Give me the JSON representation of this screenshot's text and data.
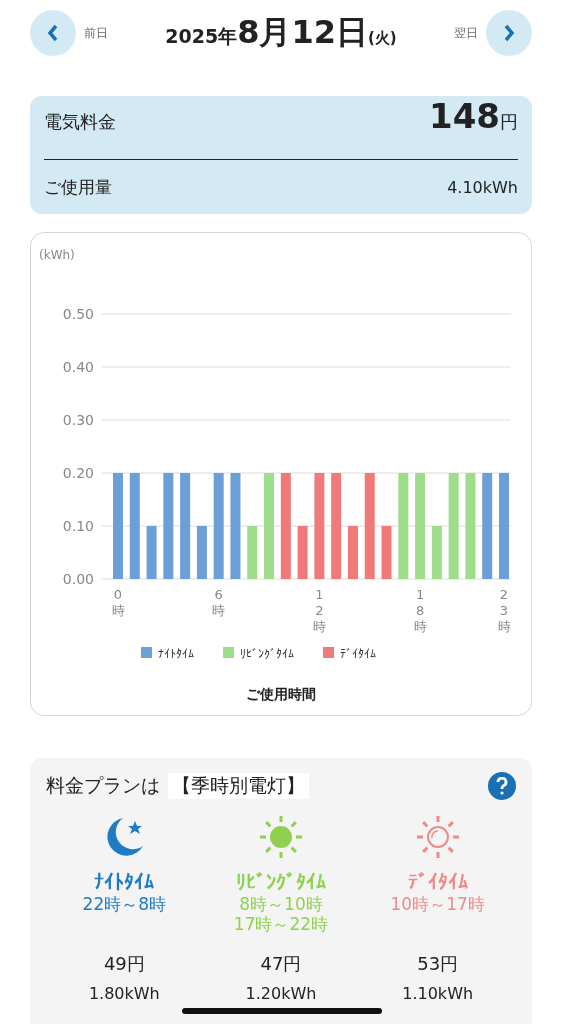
{
  "header": {
    "prev_label": "前日",
    "next_label": "翌日",
    "year": "2025年",
    "month_day": "8月12日",
    "weekday": "(火)"
  },
  "summary": {
    "charge_label": "電気料金",
    "charge_value": "148",
    "charge_unit": "円",
    "usage_label": "ご使用量",
    "usage_value": "4.10kWh"
  },
  "usage_chart": {
    "unit_label": "(kWh)",
    "chart_data": {
      "type": "bar",
      "stacked": true,
      "xlabel": "ご使用時間",
      "x": [
        0,
        1,
        2,
        3,
        4,
        5,
        6,
        7,
        8,
        9,
        10,
        11,
        12,
        13,
        14,
        15,
        16,
        17,
        18,
        19,
        20,
        21,
        22,
        23
      ],
      "grid": true,
      "legend": true,
      "xlim": [
        0,
        23
      ],
      "series": [
        {
          "name": "ﾅｲﾄﾀｲﾑ",
          "color": "#6a9fd8",
          "values": [
            0.2,
            0.2,
            0.1,
            0.2,
            0.2,
            0.1,
            0.2,
            0.2,
            null,
            null,
            null,
            null,
            null,
            null,
            null,
            null,
            null,
            null,
            null,
            null,
            null,
            null,
            0.2,
            0.2
          ]
        },
        {
          "name": "ﾘﾋﾞﾝｸﾞﾀｲﾑ",
          "color": "#9ede8a",
          "values": [
            null,
            null,
            null,
            null,
            null,
            null,
            null,
            null,
            0.1,
            0.2,
            null,
            null,
            null,
            null,
            null,
            null,
            null,
            0.2,
            0.2,
            0.1,
            0.2,
            0.2,
            null,
            null
          ]
        },
        {
          "name": "ﾃﾞｲﾀｲﾑ",
          "color": "#f07a7a",
          "values": [
            null,
            null,
            null,
            null,
            null,
            null,
            null,
            null,
            null,
            null,
            0.2,
            0.1,
            0.2,
            0.2,
            0.1,
            0.2,
            0.1,
            null,
            null,
            null,
            null,
            null,
            null,
            null
          ]
        }
      ],
      "ylim": [
        0,
        0.5
      ],
      "yticks": [
        {
          "value": 0,
          "label": "0.00"
        },
        {
          "value": 0.1,
          "label": "0.10"
        },
        {
          "value": 0.2,
          "label": "0.20"
        },
        {
          "value": 0.3,
          "label": "0.30"
        },
        {
          "value": 0.4,
          "label": "0.40"
        },
        {
          "value": 0.5,
          "label": "0.50"
        }
      ],
      "xticks": [
        {
          "value": 0,
          "label": "0時"
        },
        {
          "value": 6,
          "label": "6時"
        },
        {
          "value": 12,
          "label": "12時"
        },
        {
          "value": 18,
          "label": "18時"
        },
        {
          "value": 23,
          "label": "23時"
        }
      ]
    }
  },
  "plan": {
    "title": "料金プランは",
    "plan_name": "【季時別電灯】",
    "tiers": [
      {
        "kind": "night",
        "name": "ﾅｲﾄﾀｲﾑ",
        "color": "#1e7bc4",
        "hours": [
          "22時～8時"
        ],
        "charge": "49円",
        "usage": "1.80kWh"
      },
      {
        "kind": "living",
        "name": "ﾘﾋﾞﾝｸﾞﾀｲﾑ",
        "color": "#8fd14f",
        "hours": [
          "8時～10時",
          "17時～22時"
        ],
        "charge": "47円",
        "usage": "1.20kWh"
      },
      {
        "kind": "day",
        "name": "ﾃﾞｲﾀｲﾑ",
        "color": "#f08a8a",
        "hours": [
          "10時～17時"
        ],
        "charge": "53円",
        "usage": "1.10kWh"
      }
    ]
  }
}
